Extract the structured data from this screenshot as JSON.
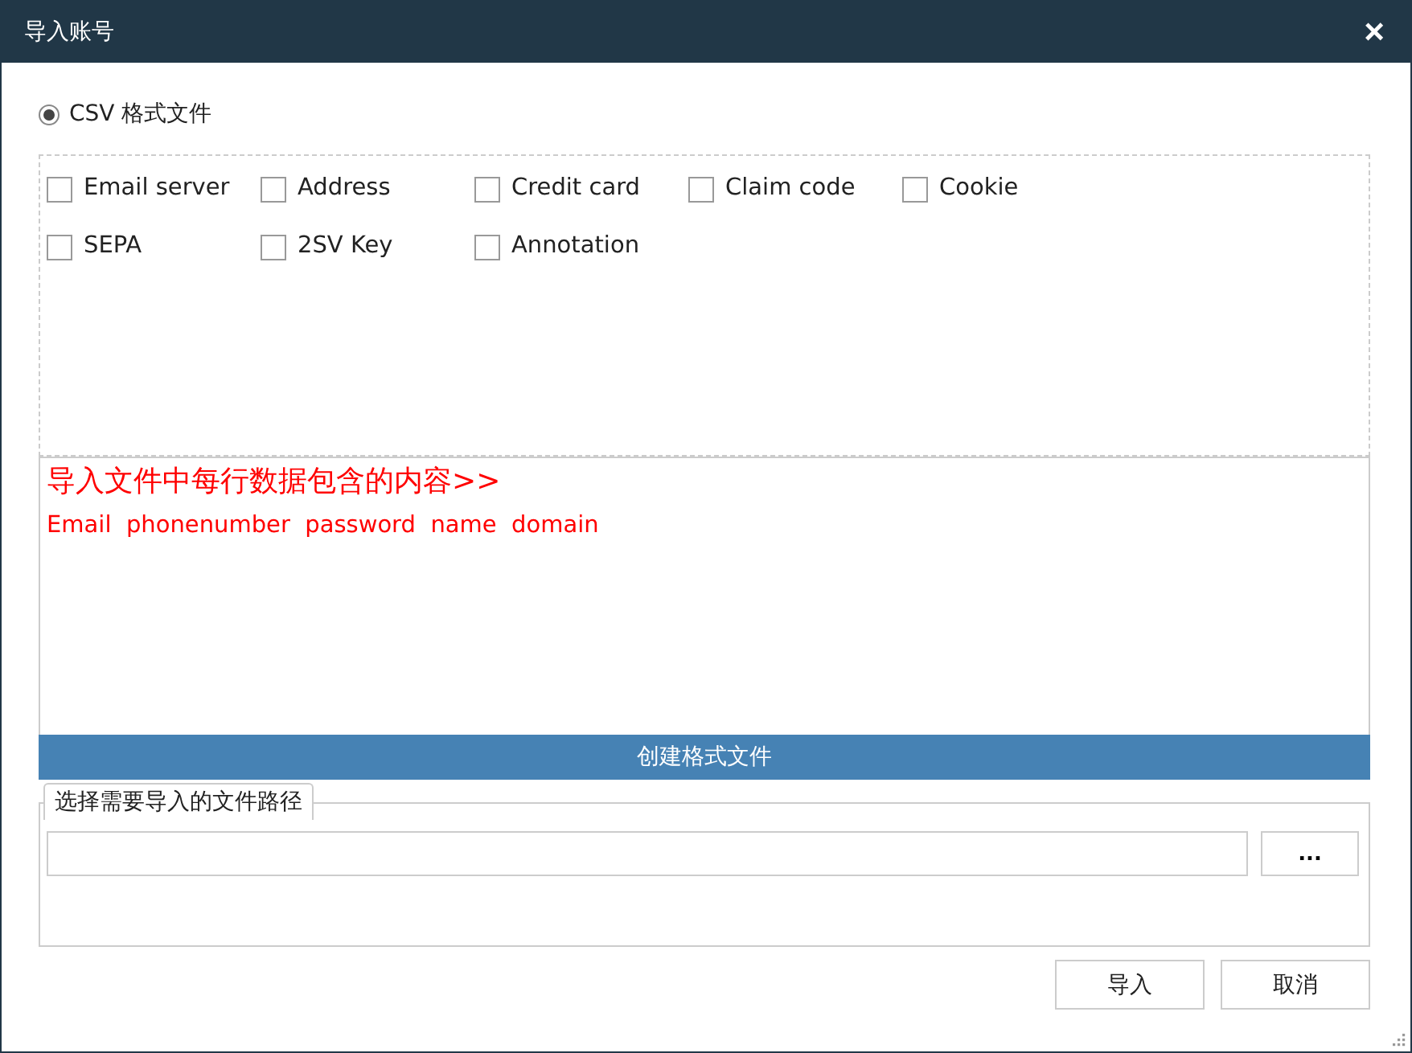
{
  "window": {
    "title": "导入账号",
    "close": "×"
  },
  "format_option": {
    "label": "CSV 格式文件",
    "selected": true
  },
  "fields": [
    {
      "label": "Email server",
      "checked": false
    },
    {
      "label": "Address",
      "checked": false
    },
    {
      "label": "Credit card",
      "checked": false
    },
    {
      "label": "Claim code",
      "checked": false
    },
    {
      "label": "Cookie",
      "checked": false
    },
    {
      "label": "SEPA",
      "checked": false
    },
    {
      "label": "2SV Key",
      "checked": false
    },
    {
      "label": "Annotation",
      "checked": false
    }
  ],
  "preview": {
    "heading": "导入文件中每行数据包含的内容>>",
    "columns": "Email  phonenumber  password  name  domain"
  },
  "create_button": "创建格式文件",
  "file_group": {
    "legend": "选择需要导入的文件路径",
    "browse": "..."
  },
  "buttons": [
    "导入",
    "取消"
  ]
}
